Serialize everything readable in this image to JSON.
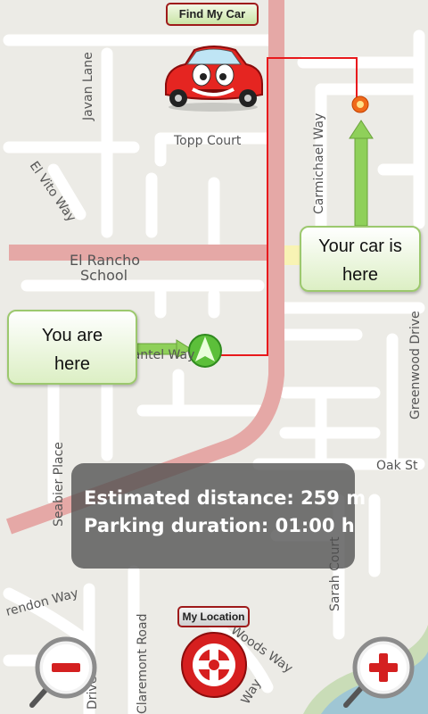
{
  "header": {
    "find_my_car_label": "Find My Car"
  },
  "map": {
    "streets": {
      "javan_lane": "Javan Lane",
      "topp_court": "Topp Court",
      "el_vito_way": "El Vito Way",
      "carmichael_way": "Carmichael Way",
      "el_rancho_school_line1": "El Rancho",
      "el_rancho_school_line2": "School",
      "seabier_place": "Seabier Place",
      "oak_st": "Oak St",
      "sarah_court": "Sarah Court",
      "endon_way": "rendon Way",
      "claremont_road": "Claremont Road",
      "drive": "Drive",
      "woods_way": "Woods Way",
      "way": "Way",
      "chantel_way": "Chantel Way",
      "greenwood_drive": "Greenwood Drive"
    }
  },
  "callouts": {
    "car": {
      "line1": "Your car is",
      "line2": "here"
    },
    "you": {
      "line1": "You are",
      "line2": "here"
    }
  },
  "info": {
    "distance_text": "Estimated distance: 259 m",
    "duration_text": "Parking duration: 01:00 h"
  },
  "footer": {
    "my_location_label": "My Location"
  },
  "icons": {
    "zoom_out": "zoom-out-magnifier-icon",
    "zoom_in": "zoom-in-magnifier-icon",
    "center": "lifebuoy-icon",
    "car": "cartoon-car-icon",
    "user_position": "green-arrow-icon",
    "car_pin": "car-pin-icon"
  },
  "colors": {
    "map_background": "#ecebe6",
    "main_road": "#e5a8a6",
    "route": "#e8191c",
    "callout_border": "#9cc86e",
    "button_border": "#9e1a1a",
    "info_panel": "#505050"
  }
}
